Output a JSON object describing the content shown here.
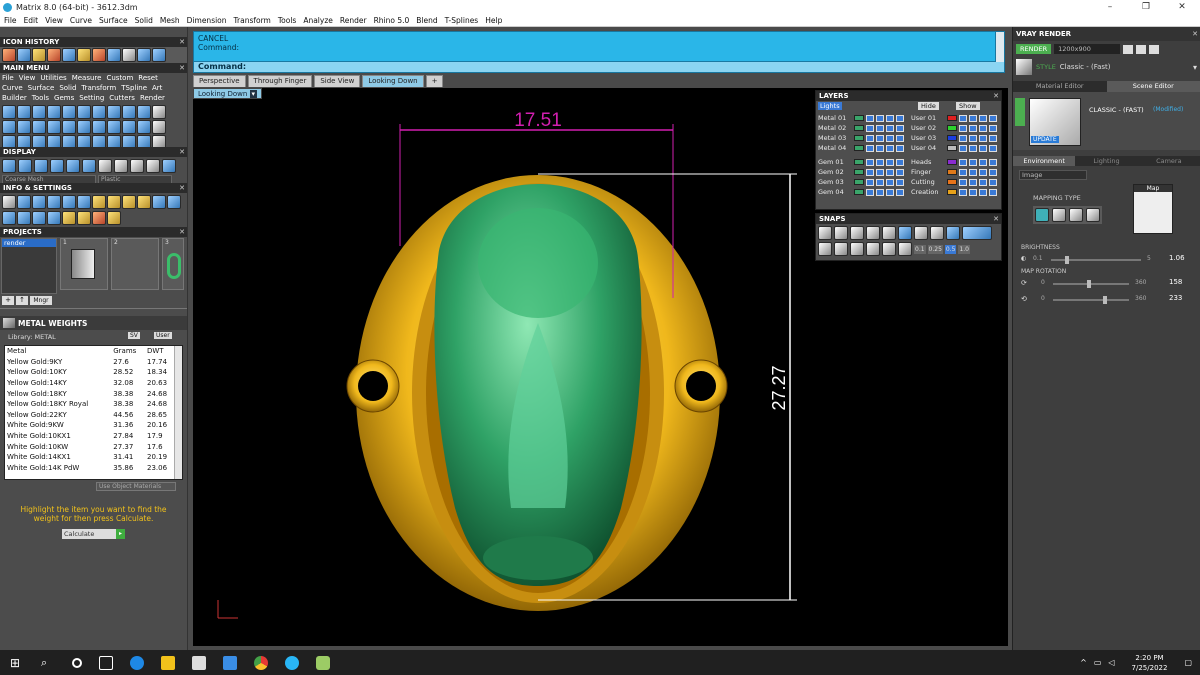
{
  "window": {
    "title": "Matrix 8.0 (64-bit) - 3612.3dm"
  },
  "menu": [
    "File",
    "Edit",
    "View",
    "Curve",
    "Surface",
    "Solid",
    "Mesh",
    "Dimension",
    "Transform",
    "Tools",
    "Analyze",
    "Render",
    "Rhino 5.0",
    "Blend",
    "T-Splines",
    "Help"
  ],
  "left": {
    "icon_history": "ICON HISTORY",
    "main_menu": "MAIN MENU",
    "main_menu_rows": [
      [
        "File",
        "View",
        "Utilities",
        "Measure",
        "Custom",
        "Reset"
      ],
      [
        "Curve",
        "Surface",
        "Solid",
        "Transform",
        "TSpline",
        "Art"
      ],
      [
        "Builder",
        "Tools",
        "Gems",
        "Setting",
        "Cutters",
        "Render"
      ]
    ],
    "display": "DISPLAY",
    "display_selects": [
      "Coarse Mesh",
      "Plastic"
    ],
    "info_settings": "INFO & SETTINGS",
    "projects": "PROJECTS",
    "project_item": "render",
    "project_slots": [
      "1",
      "2",
      "3"
    ],
    "project_mngr": "Mngr",
    "metal_weights": {
      "title": "METAL WEIGHTS",
      "library": "Library: METAL",
      "sv": "SV",
      "user": "User",
      "headers": [
        "Metal",
        "Grams",
        "DWT"
      ],
      "rows": [
        [
          "Yellow Gold:9KY",
          "27.6",
          "17.74"
        ],
        [
          "Yellow Gold:10KY",
          "28.52",
          "18.34"
        ],
        [
          "Yellow Gold:14KY",
          "32.08",
          "20.63"
        ],
        [
          "Yellow Gold:18KY",
          "38.38",
          "24.68"
        ],
        [
          "Yellow Gold:18KY Royal",
          "38.38",
          "24.68"
        ],
        [
          "Yellow Gold:22KY",
          "44.56",
          "28.65"
        ],
        [
          "White Gold:9KW",
          "31.36",
          "20.16"
        ],
        [
          "White Gold:10KX1",
          "27.84",
          "17.9"
        ],
        [
          "White Gold:10KW",
          "27.37",
          "17.6"
        ],
        [
          "White Gold:14KX1",
          "31.41",
          "20.19"
        ],
        [
          "White Gold:14K PdW",
          "35.86",
          "23.06"
        ]
      ],
      "use_object_materials": "Use Object Materials",
      "hint": "Highlight the item you want to find the weight for then press Calculate.",
      "calculate": "Calculate"
    }
  },
  "command": {
    "cancel": "CANCEL",
    "prompt1": "Command:",
    "prompt2": "Command:"
  },
  "viewtabs": [
    "Perspective",
    "Through Finger",
    "Side View",
    "Looking Down"
  ],
  "viewport": {
    "dropdown": "Looking Down",
    "dim_width": "17.51",
    "dim_height": "27.27"
  },
  "layers": {
    "title": "LAYERS",
    "lights": "Lights",
    "hide": "Hide",
    "show": "Show",
    "left": [
      {
        "name": "Metal 01",
        "color": "#3aa56a"
      },
      {
        "name": "Metal 02",
        "color": "#3aa56a"
      },
      {
        "name": "Metal 03",
        "color": "#3aa56a"
      },
      {
        "name": "Metal 04",
        "color": "#3aa56a"
      },
      {
        "name": "Gem 01",
        "color": "#3aa56a"
      },
      {
        "name": "Gem 02",
        "color": "#3aa56a"
      },
      {
        "name": "Gem 03",
        "color": "#3aa56a"
      },
      {
        "name": "Gem 04",
        "color": "#3aa56a"
      }
    ],
    "right": [
      {
        "name": "User 01",
        "color": "#e02020"
      },
      {
        "name": "User 02",
        "color": "#2ed12e"
      },
      {
        "name": "User 03",
        "color": "#1c3fe0"
      },
      {
        "name": "User 04",
        "color": "#bbbbbb"
      },
      {
        "name": "Heads",
        "color": "#8a2bd1"
      },
      {
        "name": "Finger",
        "color": "#e07a1a"
      },
      {
        "name": "Cutting",
        "color": "#e8741a"
      },
      {
        "name": "Creation",
        "color": "#e8a21a"
      }
    ]
  },
  "snaps": {
    "title": "SNAPS",
    "values": [
      "0.1",
      "0.25",
      "0.5",
      "1.0"
    ]
  },
  "vray": {
    "title": "VRAY RENDER",
    "render": "RENDER",
    "resolution": "1200x900",
    "style_label": "STYLE",
    "style_value": "Classic - (Fast)",
    "tabs": [
      "Material Editor",
      "Scene Editor"
    ],
    "scene_name": "CLASSIC - (FAST)",
    "modified": "(Modified)",
    "update": "UPDATE",
    "subtabs": [
      "Environment",
      "Lighting",
      "Camera"
    ],
    "env_select": "Image",
    "mapping_type": "MAPPING TYPE",
    "map": "Map",
    "brightness": "BRIGHTNESS",
    "brightness_min": "0.1",
    "brightness_max": "5",
    "brightness_val": "1.06",
    "map_rotation": "MAP ROTATION",
    "rot1_min": "0",
    "rot1_max": "360",
    "rot1_val": "158",
    "rot2_min": "0",
    "rot2_max": "360",
    "rot2_val": "233"
  },
  "taskbar": {
    "time": "2:20 PM",
    "date": "7/25/2022"
  }
}
